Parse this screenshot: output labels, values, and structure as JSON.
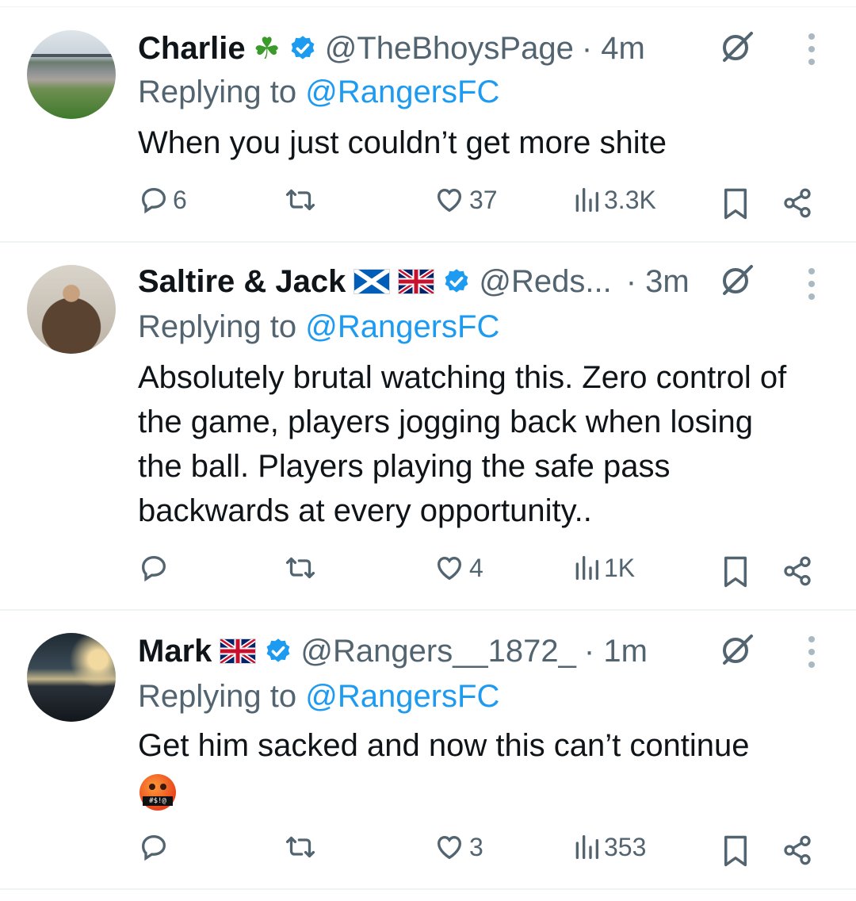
{
  "tweets": [
    {
      "name": "Charlie",
      "name_suffix": "☘",
      "handle": "@TheBhoysPage",
      "time": "· 4m",
      "replying_label": "Replying to ",
      "replying_to": "@RangersFC",
      "text_lines": [
        "When you just couldn’t get more shite"
      ],
      "replies": "6",
      "reposts": "",
      "likes": "37",
      "views": "3.3K"
    },
    {
      "name": "Saltire & Jack",
      "handle": "@Reds...",
      "time": "· 3m",
      "replying_label": "Replying to ",
      "replying_to": "@RangersFC",
      "text_lines": [
        "Absolutely brutal watching this. Zero control of",
        "the game, players jogging back when losing",
        "the ball. Players playing the safe pass",
        "backwards at every opportunity.."
      ],
      "replies": "",
      "reposts": "",
      "likes": "4",
      "views": "1K"
    },
    {
      "name": "Mark",
      "handle": "@Rangers__1872_",
      "time": "· 1m",
      "replying_label": "Replying to ",
      "replying_to": "@RangersFC",
      "text_lines": [
        "Get him sacked and now this can’t continue"
      ],
      "emoji_text": "#$!@",
      "replies": "",
      "reposts": "",
      "likes": "3",
      "views": "353"
    }
  ],
  "colors": {
    "accent": "#1d9bf0",
    "muted": "#536471",
    "text": "#0f1419",
    "divider": "#eff3f4",
    "shamrock": "#3a9a2a"
  },
  "icons": [
    "verified-badge-icon",
    "scotland-flag-icon",
    "uk-flag-icon",
    "no-entry-icon",
    "more-vertical-icon",
    "reply-icon",
    "repost-icon",
    "like-icon",
    "views-icon",
    "bookmark-icon",
    "share-icon",
    "face-with-symbols-emoji-icon"
  ]
}
